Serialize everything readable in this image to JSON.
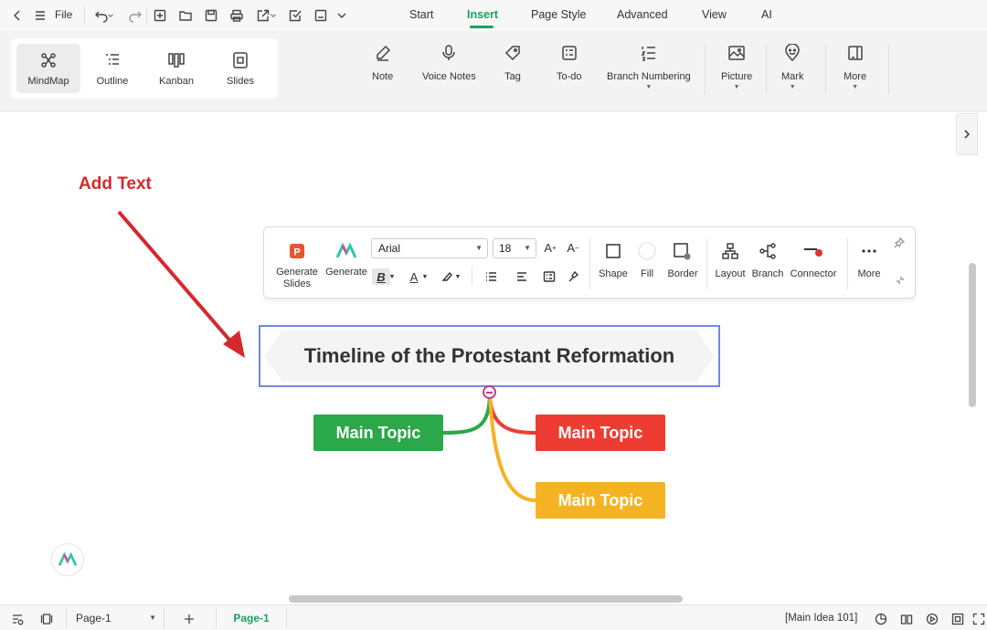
{
  "titlebar": {
    "file_label": "File",
    "tabs": [
      "Start",
      "Insert",
      "Page Style",
      "Advanced",
      "View",
      "AI"
    ],
    "active_tab": "Insert"
  },
  "ribbon": {
    "views": [
      "MindMap",
      "Outline",
      "Kanban",
      "Slides"
    ],
    "active_view": "MindMap",
    "buttons": {
      "note": "Note",
      "voice_notes": "Voice Notes",
      "tag": "Tag",
      "todo": "To-do",
      "branch_numbering": "Branch Numbering",
      "picture": "Picture",
      "mark": "Mark",
      "more": "More"
    }
  },
  "annotation": {
    "text": "Add Text",
    "color": "#d6282b"
  },
  "floatbar": {
    "generate_slides": "Generate Slides",
    "generate": "Generate",
    "font": "Arial",
    "size": "18",
    "shape": "Shape",
    "fill": "Fill",
    "border": "Border",
    "layout": "Layout",
    "branch": "Branch",
    "connector": "Connector",
    "more": "More"
  },
  "mindmap": {
    "central": "Timeline of the Protestant Reformation",
    "topics": [
      {
        "label": "Main Topic",
        "color": "#2aa84a"
      },
      {
        "label": "Main Topic",
        "color": "#ef3c33"
      },
      {
        "label": "Main Topic",
        "color": "#f5b324"
      }
    ],
    "border_color": "#6f8bde"
  },
  "statusbar": {
    "page_select": "Page-1",
    "page_tab": "Page-1",
    "status": "[Main Idea 101]"
  },
  "colors": {
    "accent": "#1aa260"
  }
}
